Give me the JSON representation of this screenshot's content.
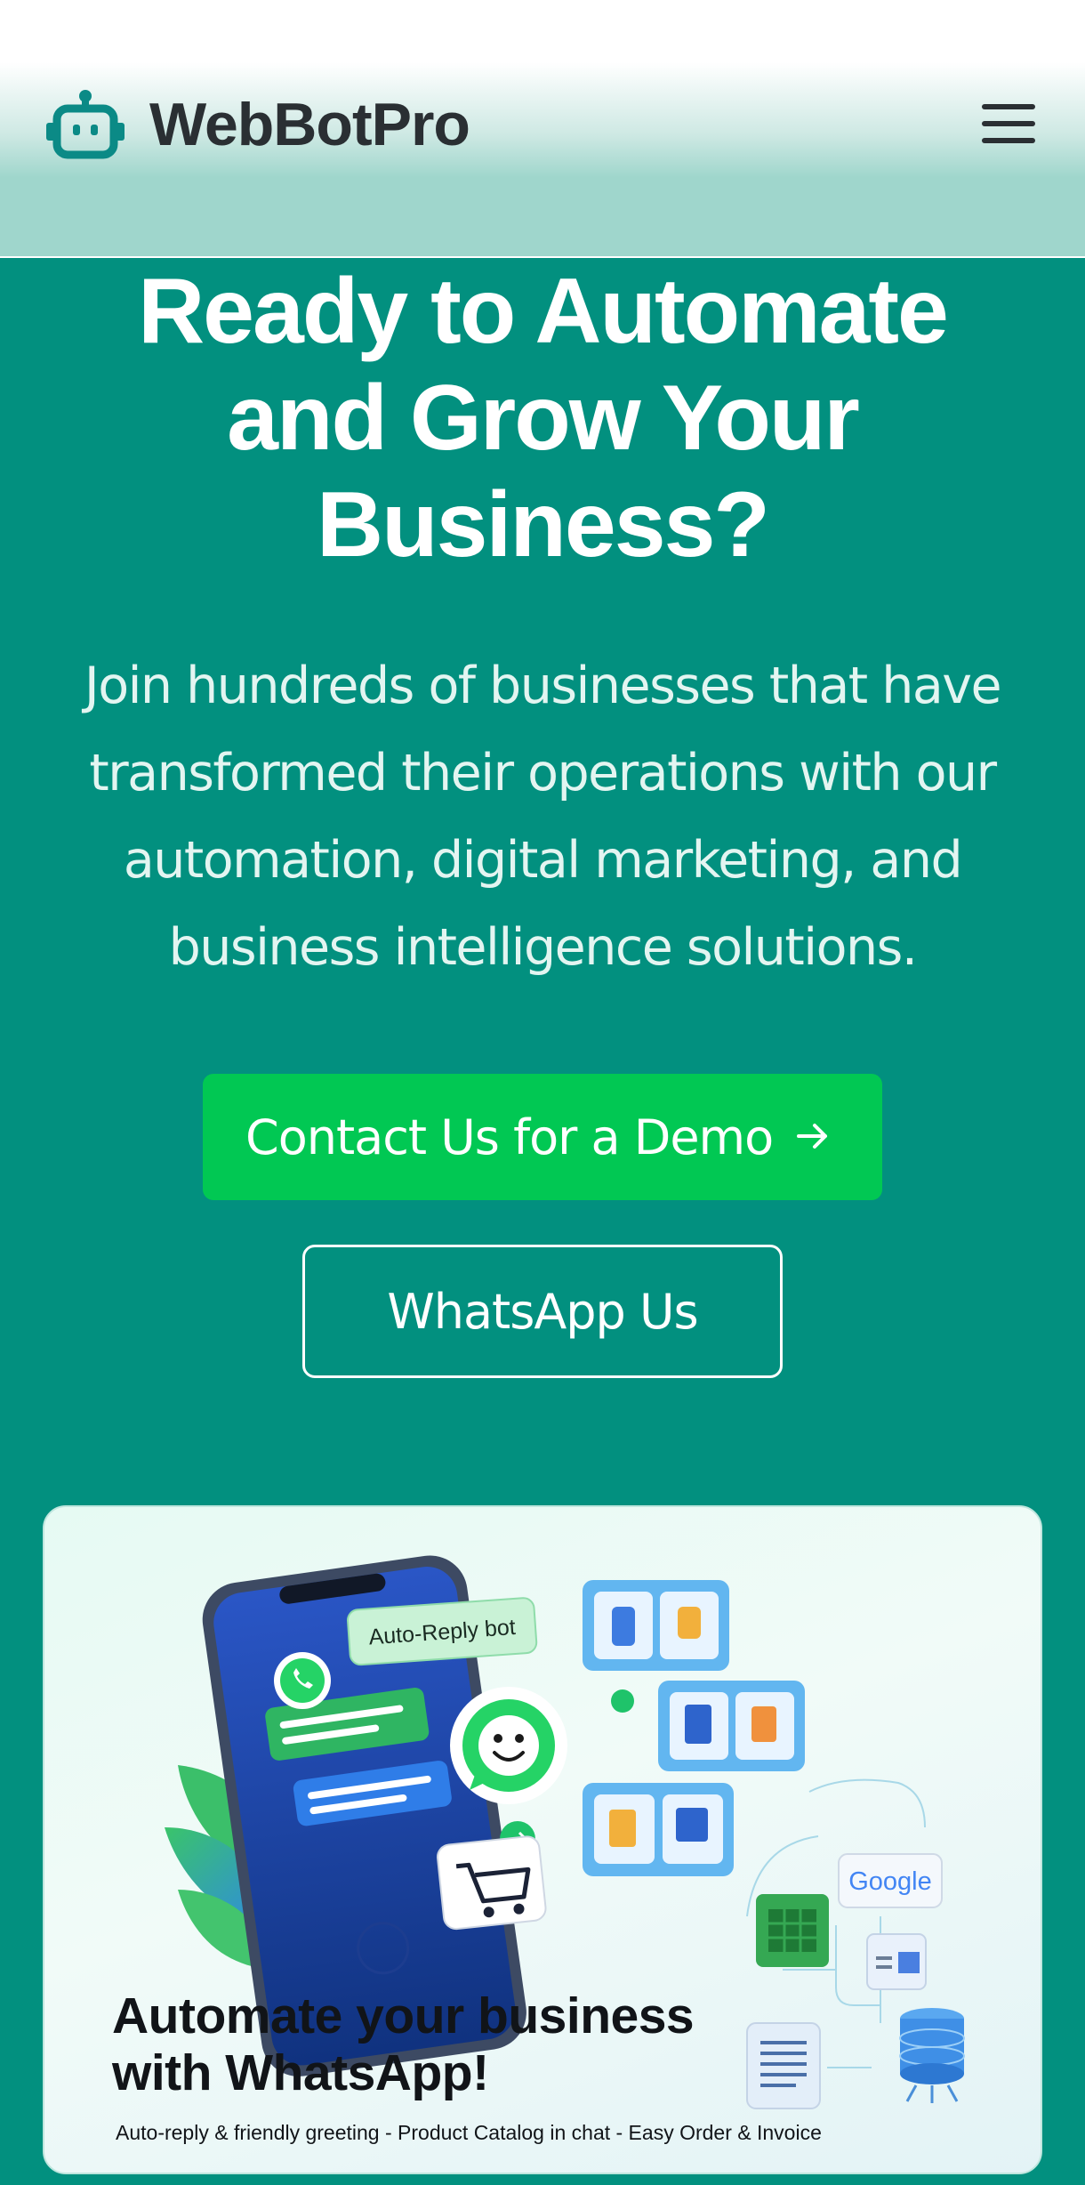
{
  "brand": {
    "name": "WebBotPro",
    "logo_icon": "robot-icon"
  },
  "header": {
    "menu_icon": "hamburger-menu-icon"
  },
  "hero": {
    "title": "Ready to Automate and Grow Your Business?",
    "subtitle": "Join hundreds of businesses that have transformed their operations with our automation, digital marketing, and business intelligence solutions."
  },
  "buttons": {
    "demo_label": "Contact Us for a Demo",
    "demo_icon": "arrow-right-icon",
    "whatsapp_label": "WhatsApp Us"
  },
  "promo_card": {
    "bot_tag": "Auto-Reply bot",
    "google_label": "Google",
    "headline": "Automate your business with WhatsApp!",
    "features": "Auto-reply & friendly greeting - Product Catalog in chat - Easy Order & Invoice",
    "icons": [
      "whatsapp-icon",
      "cart-icon",
      "google-icon",
      "spreadsheet-icon",
      "document-icon",
      "database-icon"
    ]
  },
  "colors": {
    "teal": "#02907f",
    "green": "#01c853",
    "header_tint": "#9fd6cc",
    "dark_text": "#2a2f33"
  }
}
